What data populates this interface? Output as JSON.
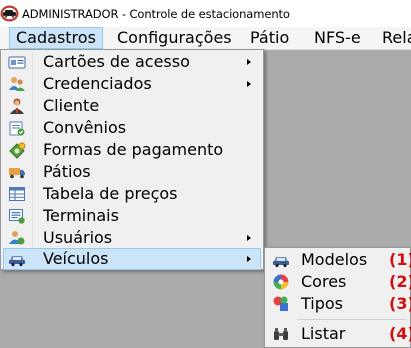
{
  "window": {
    "title": "ADMINISTRADOR - Controle de estacionamento",
    "app_icon": "parking-app-icon"
  },
  "menubar": {
    "items": [
      {
        "label": "Cadastros",
        "active": true
      },
      {
        "label": "Configurações",
        "active": false
      },
      {
        "label": "Pátio",
        "active": false
      },
      {
        "label": "NFS-e",
        "active": false
      },
      {
        "label": "Rela",
        "active": false
      }
    ]
  },
  "cadastros_menu": {
    "items": [
      {
        "label": "Cartões de acesso",
        "icon": "access-card-icon",
        "submenu": true
      },
      {
        "label": "Credenciados",
        "icon": "credentialed-users-icon",
        "submenu": true
      },
      {
        "label": "Cliente",
        "icon": "client-icon",
        "submenu": false
      },
      {
        "label": "Convênios",
        "icon": "agreement-icon",
        "submenu": false
      },
      {
        "label": "Formas de pagamento",
        "icon": "payment-method-icon",
        "submenu": false
      },
      {
        "label": "Pátios",
        "icon": "truck-icon",
        "submenu": false
      },
      {
        "label": "Tabela de preços",
        "icon": "price-table-icon",
        "submenu": false
      },
      {
        "label": "Terminais",
        "icon": "terminal-icon",
        "submenu": false
      },
      {
        "label": "Usuários",
        "icon": "users-icon",
        "submenu": true
      },
      {
        "label": "Veículos",
        "icon": "car-icon",
        "submenu": true,
        "highlighted": true
      }
    ]
  },
  "veiculos_submenu": {
    "items": [
      {
        "label": "Modelos",
        "annotation": "(1)",
        "icon": "car-model-icon"
      },
      {
        "label": "Cores",
        "annotation": "(2)",
        "icon": "color-wheel-icon"
      },
      {
        "label": "Tipos",
        "annotation": "(3)",
        "icon": "shapes-icon"
      },
      {
        "label": "Listar",
        "annotation": "(4)",
        "icon": "binoculars-icon"
      }
    ]
  },
  "colors": {
    "highlight": "#cce4f7",
    "highlight_border": "#99c9ef",
    "annotation": "#d01010",
    "background": "#ababab"
  }
}
